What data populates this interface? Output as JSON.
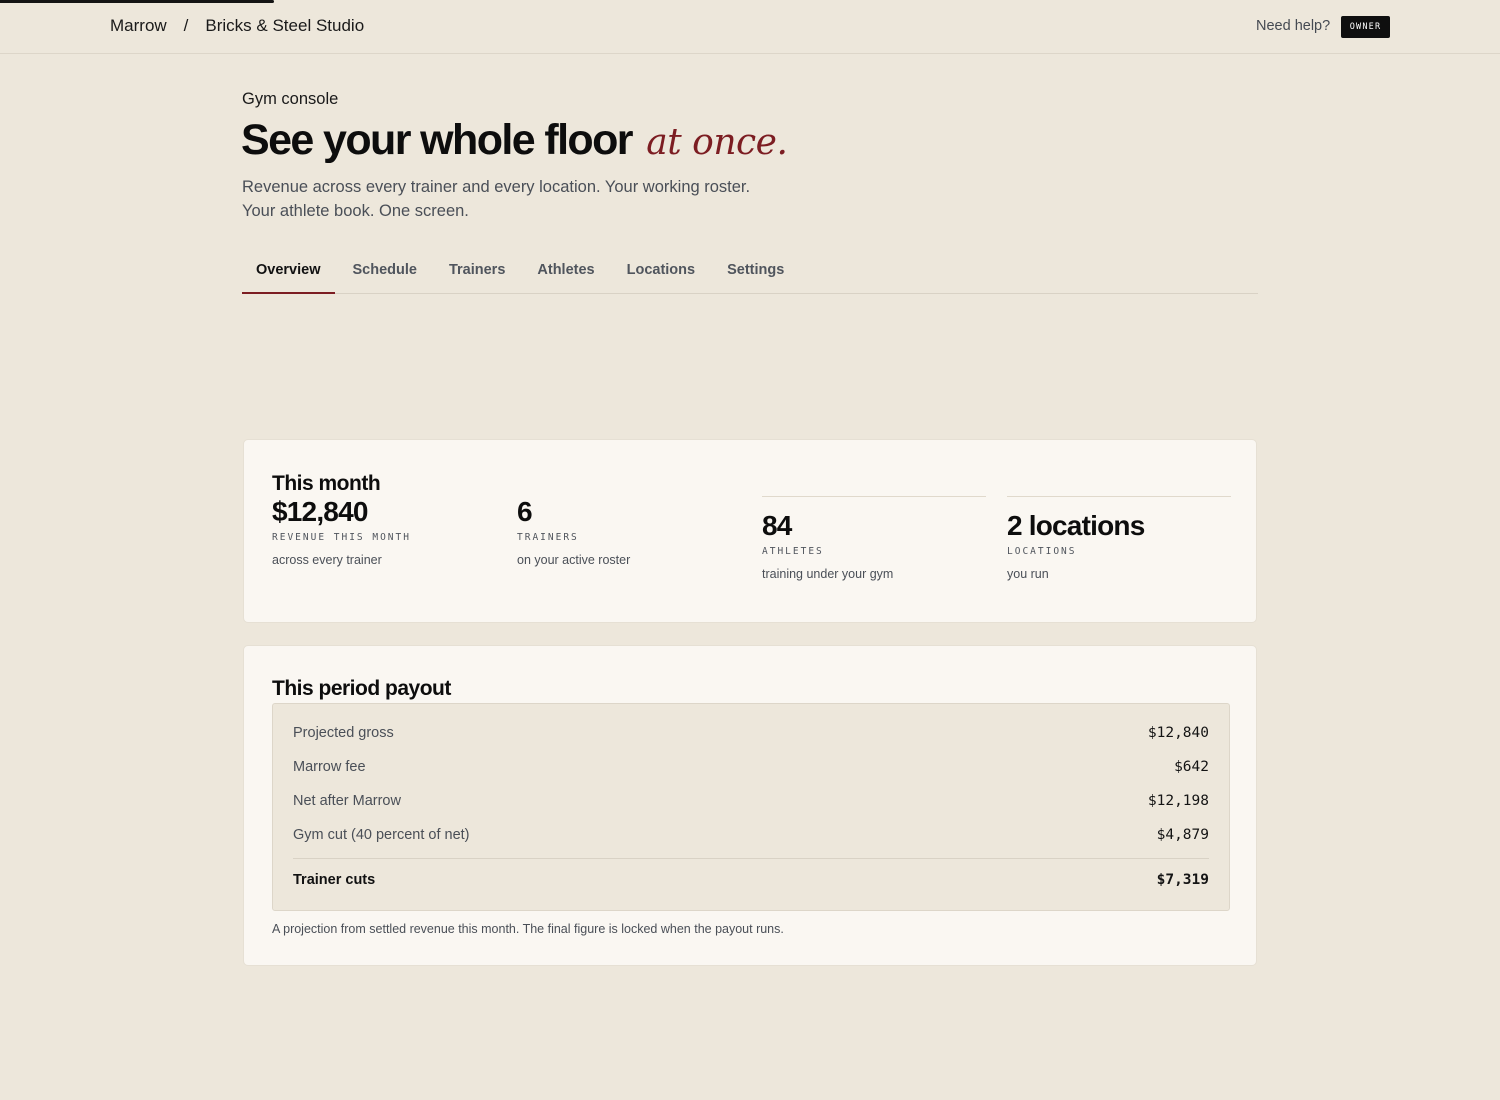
{
  "header": {
    "brand": "Marrow",
    "separator": "/",
    "studio": "Bricks & Steel Studio",
    "help_label": "Need help?",
    "role_badge": "OWNER"
  },
  "intro": {
    "eyebrow": "Gym console",
    "headline": "See your whole floor",
    "headline_accent": "at once.",
    "lede": "Revenue across every trainer and every location. Your working roster. Your athlete book. One screen."
  },
  "tabs": [
    {
      "label": "Overview",
      "active": true
    },
    {
      "label": "Schedule",
      "active": false
    },
    {
      "label": "Trainers",
      "active": false
    },
    {
      "label": "Athletes",
      "active": false
    },
    {
      "label": "Locations",
      "active": false
    },
    {
      "label": "Settings",
      "active": false
    }
  ],
  "stats": {
    "title": "This month",
    "items": [
      {
        "value": "$12,840",
        "label": "REVENUE THIS MONTH",
        "note": "across every trainer"
      },
      {
        "value": "6",
        "label": "TRAINERS",
        "note": "on your active roster"
      },
      {
        "value": "84",
        "label": "ATHLETES",
        "note": "training under your gym"
      },
      {
        "value": "2 locations",
        "label": "LOCATIONS",
        "note": "you run"
      }
    ]
  },
  "payout": {
    "title": "This period payout",
    "rows": [
      {
        "label": "Projected gross",
        "amount": "$12,840"
      },
      {
        "label": "Marrow fee",
        "amount": "$642"
      },
      {
        "label": "Net after Marrow",
        "amount": "$12,198"
      },
      {
        "label": "Gym cut (40 percent of net)",
        "amount": "$4,879"
      }
    ],
    "total": {
      "label": "Trainer cuts",
      "amount": "$7,319"
    },
    "footnote": "A projection from settled revenue this month. The final figure is locked when the payout runs."
  },
  "colors": {
    "background": "#ede7db",
    "card": "#faf7f2",
    "accent": "#7c1d22",
    "ink": "#0d0d0d"
  }
}
